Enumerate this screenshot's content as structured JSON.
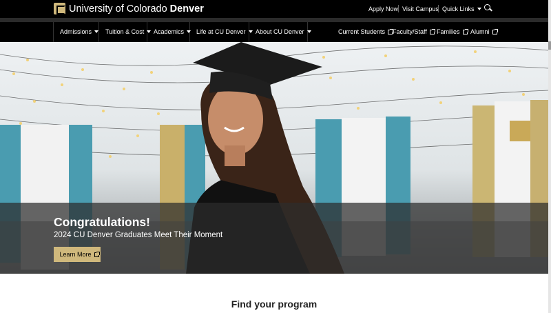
{
  "header": {
    "brand_prefix": "University of Colorado ",
    "brand_bold": "Denver",
    "utility_links": [
      "Apply Now",
      "Visit Campus",
      "Quick Links"
    ]
  },
  "nav": {
    "main": [
      "Admissions",
      "Tuition & Cost",
      "Academics",
      "Life at CU Denver",
      "About CU Denver"
    ],
    "audience": [
      "Current Students",
      "Faculty/Staff",
      "Families",
      "Alumni"
    ]
  },
  "hero": {
    "title": "Congratulations!",
    "subtitle": "2024 CU Denver Graduates Meet Their Moment",
    "cta": "Learn More"
  },
  "section": {
    "title": "Find your program"
  },
  "colors": {
    "gold": "#cfb87c",
    "black": "#000000",
    "teal": "#4a9cb0"
  }
}
